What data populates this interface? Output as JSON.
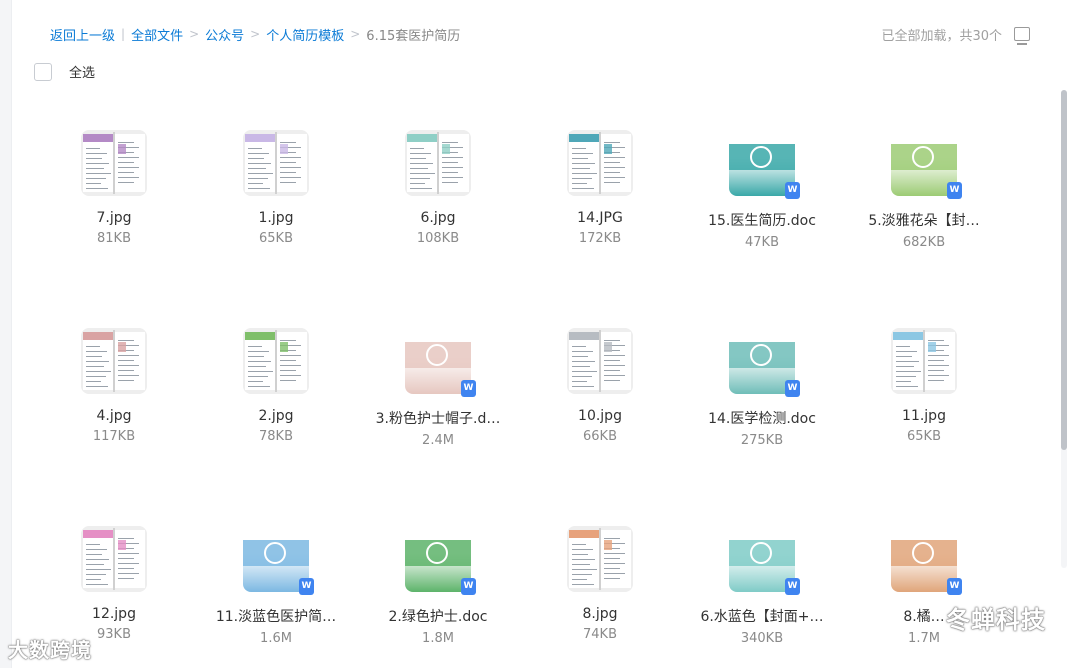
{
  "breadcrumb": {
    "back": "返回上一级",
    "sep1": "|",
    "all_files": "全部文件",
    "sep": ">",
    "folder1": "公众号",
    "folder2": "个人简历模板",
    "current": "6.15套医护简历"
  },
  "status": {
    "loaded_text": "已全部加载，共30个"
  },
  "select_all": {
    "label": "全选"
  },
  "files": [
    {
      "name": "7.jpg",
      "size": "81KB",
      "type": "jpg",
      "accent": "#b48ac6"
    },
    {
      "name": "1.jpg",
      "size": "65KB",
      "type": "jpg",
      "accent": "#c9b8e6"
    },
    {
      "name": "6.jpg",
      "size": "108KB",
      "type": "jpg",
      "accent": "#8fcfc6"
    },
    {
      "name": "14.JPG",
      "size": "172KB",
      "type": "jpg",
      "accent": "#4fa7b8"
    },
    {
      "name": "15.医生简历.doc",
      "size": "47KB",
      "type": "doc",
      "accent": "#3aa8a8"
    },
    {
      "name": "5.淡雅花朵【封…",
      "size": "682KB",
      "type": "doc",
      "accent": "#9ccb74"
    },
    {
      "name": "4.jpg",
      "size": "117KB",
      "type": "jpg",
      "accent": "#d9a3a3"
    },
    {
      "name": "2.jpg",
      "size": "78KB",
      "type": "jpg",
      "accent": "#7fbf6a"
    },
    {
      "name": "3.粉色护士帽子.d…",
      "size": "2.4M",
      "type": "doc",
      "accent": "#e6c7c0"
    },
    {
      "name": "10.jpg",
      "size": "66KB",
      "type": "jpg",
      "accent": "#b7bcc2"
    },
    {
      "name": "14.医学检测.doc",
      "size": "275KB",
      "type": "doc",
      "accent": "#6fbdb8"
    },
    {
      "name": "11.jpg",
      "size": "65KB",
      "type": "jpg",
      "accent": "#8cc7e3"
    },
    {
      "name": "12.jpg",
      "size": "93KB",
      "type": "jpg",
      "accent": "#e58fc5"
    },
    {
      "name": "11.淡蓝色医护简…",
      "size": "1.6M",
      "type": "doc",
      "accent": "#7cb8e2"
    },
    {
      "name": "2.绿色护士.doc",
      "size": "1.8M",
      "type": "doc",
      "accent": "#5db36a"
    },
    {
      "name": "8.jpg",
      "size": "74KB",
      "type": "jpg",
      "accent": "#e7a27c"
    },
    {
      "name": "6.水蓝色【封面+…",
      "size": "340KB",
      "type": "doc",
      "accent": "#7fcbc7"
    },
    {
      "name": "8.橘…",
      "size": "1.7M",
      "type": "doc",
      "accent": "#e0a57a"
    }
  ],
  "watermarks": {
    "left": "大数跨境",
    "right": "冬蝉科技"
  },
  "icons": {
    "doc_badge": "W",
    "view_toggle": "monitor-icon"
  }
}
